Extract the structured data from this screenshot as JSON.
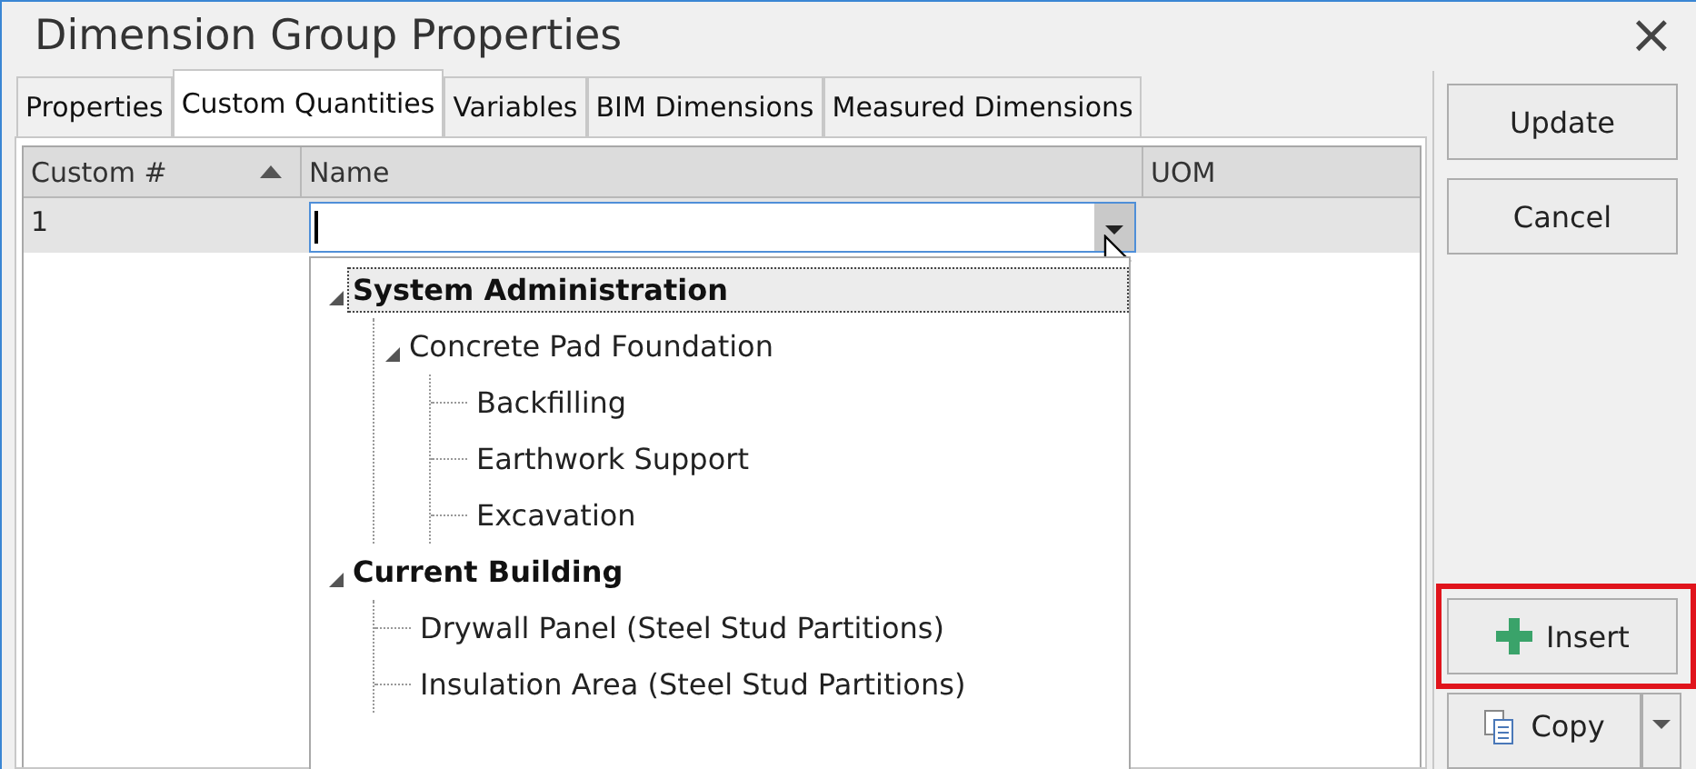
{
  "window": {
    "title": "Dimension Group Properties",
    "close": "×"
  },
  "tabs": [
    {
      "label": "Properties",
      "selected": false
    },
    {
      "label": "Custom Quantities",
      "selected": true
    },
    {
      "label": "Variables",
      "selected": false
    },
    {
      "label": "BIM Dimensions",
      "selected": false
    },
    {
      "label": "Measured Dimensions",
      "selected": false
    }
  ],
  "table": {
    "columns": [
      {
        "label": "Custom #",
        "sorted": true
      },
      {
        "label": "Name",
        "sorted": false
      },
      {
        "label": "UOM",
        "sorted": false
      }
    ],
    "rows": [
      {
        "custom_no": "1",
        "name": "",
        "uom": ""
      }
    ]
  },
  "dropdown": {
    "items": [
      {
        "label": "System Administration",
        "expanded": true,
        "selected": true,
        "children": [
          {
            "label": "Concrete Pad Foundation",
            "expanded": true,
            "selected": false,
            "children": [
              {
                "label": "Backfilling",
                "selected": false
              },
              {
                "label": "Earthwork Support",
                "selected": false
              },
              {
                "label": "Excavation",
                "selected": false
              }
            ]
          }
        ]
      },
      {
        "label": "Current Building",
        "expanded": true,
        "selected": false,
        "children": [
          {
            "label": "Drywall Panel (Steel Stud Partitions)",
            "selected": false
          },
          {
            "label": "Insulation Area (Steel Stud Partitions)",
            "selected": false
          }
        ]
      }
    ]
  },
  "buttons": [
    {
      "label": "Update",
      "kind": "plain"
    },
    {
      "label": "Cancel",
      "kind": "plain"
    },
    {
      "label": "Insert",
      "kind": "insert",
      "highlighted": true
    },
    {
      "label": "Copy",
      "kind": "split"
    }
  ]
}
